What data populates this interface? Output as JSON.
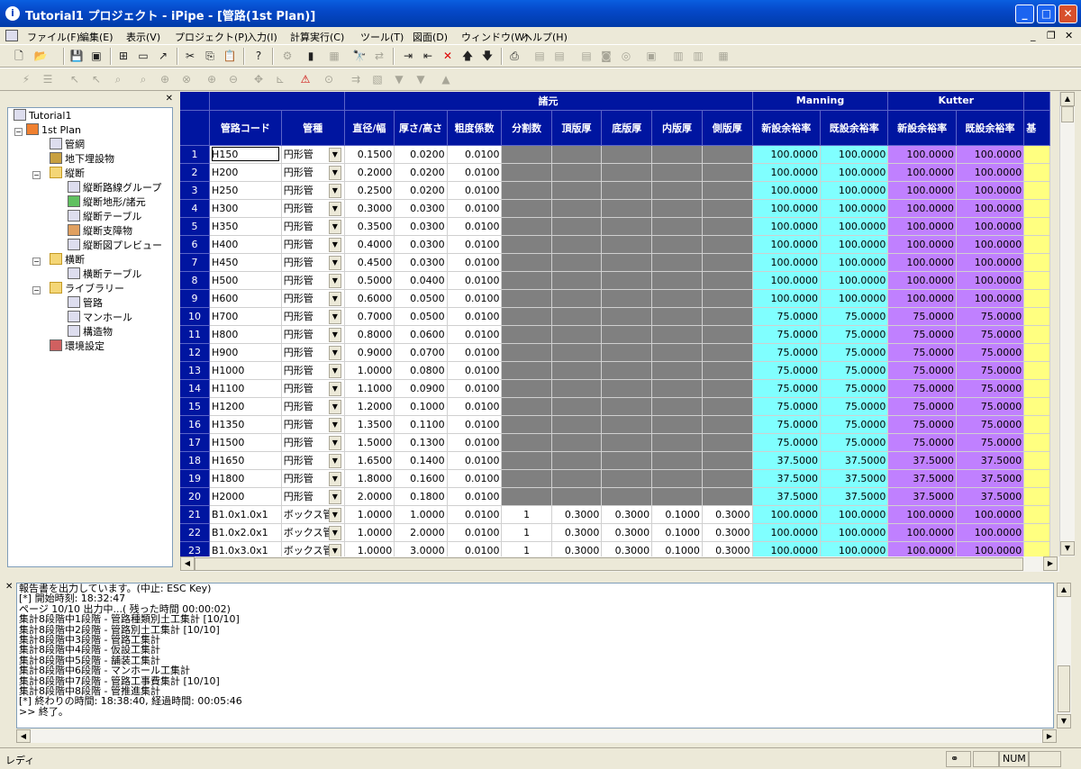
{
  "window": {
    "title": "Tutorial1 プロジェクト - iPipe - [管路(1st Plan)]"
  },
  "menu": [
    {
      "label": "ファイル(F)",
      "icon": "app-doc-icon"
    },
    {
      "label": "編集(E)"
    },
    {
      "label": "表示(V)"
    },
    {
      "label": "プロジェクト(P)"
    },
    {
      "label": "入力(I)"
    },
    {
      "label": "計算実行(C)"
    },
    {
      "label": "ツール(T)"
    },
    {
      "label": "図面(D)"
    },
    {
      "label": "ウィンドウ(W)"
    },
    {
      "label": "ヘルプ(H)"
    }
  ],
  "tree": [
    {
      "label": "Tutorial1",
      "icon": "project-icon",
      "level": 0
    },
    {
      "label": "1st Plan",
      "icon": "plan-icon",
      "level": 1,
      "expanded": true
    },
    {
      "label": "管網",
      "icon": "network-icon",
      "level": 2
    },
    {
      "label": "地下埋設物",
      "icon": "buried-icon",
      "level": 2
    },
    {
      "label": "縦断",
      "icon": "folder-icon",
      "level": 2,
      "expanded": true
    },
    {
      "label": "縦断路線グループ",
      "icon": "route-group-icon",
      "level": 3
    },
    {
      "label": "縦断地形/諸元",
      "icon": "terrain-icon",
      "level": 3
    },
    {
      "label": "縦断テーブル",
      "icon": "table-icon",
      "level": 3
    },
    {
      "label": "縦断支障物",
      "icon": "obstacle-icon",
      "level": 3
    },
    {
      "label": "縦断図プレビュー",
      "icon": "preview-icon",
      "level": 3
    },
    {
      "label": "横断",
      "icon": "folder-icon",
      "level": 2,
      "expanded": true
    },
    {
      "label": "横断テーブル",
      "icon": "table-icon",
      "level": 3
    },
    {
      "label": "ライブラリー",
      "icon": "folder-icon",
      "level": 2,
      "expanded": true
    },
    {
      "label": "管路",
      "icon": "pipe-icon",
      "level": 3,
      "selected": true
    },
    {
      "label": "マンホール",
      "icon": "manhole-icon",
      "level": 3
    },
    {
      "label": "構造物",
      "icon": "structure-icon",
      "level": 3
    },
    {
      "label": "環境設定",
      "icon": "settings-icon",
      "level": 2
    }
  ],
  "grid": {
    "group_headers": {
      "spec": "諸元",
      "manning": "Manning",
      "kutter": "Kutter"
    },
    "columns": [
      "管路コード",
      "管種",
      "直径/幅",
      "厚さ/高さ",
      "粗度係数",
      "分割数",
      "頂版厚",
      "底版厚",
      "内版厚",
      "側版厚",
      "新設余裕率",
      "既設余裕率",
      "新設余裕率",
      "既設余裕率",
      "基"
    ],
    "rows": [
      {
        "n": "1",
        "code": "H150",
        "type": "円形管",
        "d": "0.1500",
        "t": "0.0200",
        "r": "0.0100",
        "mn": "100.0000",
        "me": "100.0000",
        "kn": "100.0000",
        "ke": "100.0000"
      },
      {
        "n": "2",
        "code": "H200",
        "type": "円形管",
        "d": "0.2000",
        "t": "0.0200",
        "r": "0.0100",
        "mn": "100.0000",
        "me": "100.0000",
        "kn": "100.0000",
        "ke": "100.0000"
      },
      {
        "n": "3",
        "code": "H250",
        "type": "円形管",
        "d": "0.2500",
        "t": "0.0200",
        "r": "0.0100",
        "mn": "100.0000",
        "me": "100.0000",
        "kn": "100.0000",
        "ke": "100.0000"
      },
      {
        "n": "4",
        "code": "H300",
        "type": "円形管",
        "d": "0.3000",
        "t": "0.0300",
        "r": "0.0100",
        "mn": "100.0000",
        "me": "100.0000",
        "kn": "100.0000",
        "ke": "100.0000"
      },
      {
        "n": "5",
        "code": "H350",
        "type": "円形管",
        "d": "0.3500",
        "t": "0.0300",
        "r": "0.0100",
        "mn": "100.0000",
        "me": "100.0000",
        "kn": "100.0000",
        "ke": "100.0000"
      },
      {
        "n": "6",
        "code": "H400",
        "type": "円形管",
        "d": "0.4000",
        "t": "0.0300",
        "r": "0.0100",
        "mn": "100.0000",
        "me": "100.0000",
        "kn": "100.0000",
        "ke": "100.0000"
      },
      {
        "n": "7",
        "code": "H450",
        "type": "円形管",
        "d": "0.4500",
        "t": "0.0300",
        "r": "0.0100",
        "mn": "100.0000",
        "me": "100.0000",
        "kn": "100.0000",
        "ke": "100.0000"
      },
      {
        "n": "8",
        "code": "H500",
        "type": "円形管",
        "d": "0.5000",
        "t": "0.0400",
        "r": "0.0100",
        "mn": "100.0000",
        "me": "100.0000",
        "kn": "100.0000",
        "ke": "100.0000"
      },
      {
        "n": "9",
        "code": "H600",
        "type": "円形管",
        "d": "0.6000",
        "t": "0.0500",
        "r": "0.0100",
        "mn": "100.0000",
        "me": "100.0000",
        "kn": "100.0000",
        "ke": "100.0000"
      },
      {
        "n": "10",
        "code": "H700",
        "type": "円形管",
        "d": "0.7000",
        "t": "0.0500",
        "r": "0.0100",
        "mn": "75.0000",
        "me": "75.0000",
        "kn": "75.0000",
        "ke": "75.0000"
      },
      {
        "n": "11",
        "code": "H800",
        "type": "円形管",
        "d": "0.8000",
        "t": "0.0600",
        "r": "0.0100",
        "mn": "75.0000",
        "me": "75.0000",
        "kn": "75.0000",
        "ke": "75.0000"
      },
      {
        "n": "12",
        "code": "H900",
        "type": "円形管",
        "d": "0.9000",
        "t": "0.0700",
        "r": "0.0100",
        "mn": "75.0000",
        "me": "75.0000",
        "kn": "75.0000",
        "ke": "75.0000"
      },
      {
        "n": "13",
        "code": "H1000",
        "type": "円形管",
        "d": "1.0000",
        "t": "0.0800",
        "r": "0.0100",
        "mn": "75.0000",
        "me": "75.0000",
        "kn": "75.0000",
        "ke": "75.0000"
      },
      {
        "n": "14",
        "code": "H1100",
        "type": "円形管",
        "d": "1.1000",
        "t": "0.0900",
        "r": "0.0100",
        "mn": "75.0000",
        "me": "75.0000",
        "kn": "75.0000",
        "ke": "75.0000"
      },
      {
        "n": "15",
        "code": "H1200",
        "type": "円形管",
        "d": "1.2000",
        "t": "0.1000",
        "r": "0.0100",
        "mn": "75.0000",
        "me": "75.0000",
        "kn": "75.0000",
        "ke": "75.0000"
      },
      {
        "n": "16",
        "code": "H1350",
        "type": "円形管",
        "d": "1.3500",
        "t": "0.1100",
        "r": "0.0100",
        "mn": "75.0000",
        "me": "75.0000",
        "kn": "75.0000",
        "ke": "75.0000"
      },
      {
        "n": "17",
        "code": "H1500",
        "type": "円形管",
        "d": "1.5000",
        "t": "0.1300",
        "r": "0.0100",
        "mn": "75.0000",
        "me": "75.0000",
        "kn": "75.0000",
        "ke": "75.0000"
      },
      {
        "n": "18",
        "code": "H1650",
        "type": "円形管",
        "d": "1.6500",
        "t": "0.1400",
        "r": "0.0100",
        "mn": "37.5000",
        "me": "37.5000",
        "kn": "37.5000",
        "ke": "37.5000"
      },
      {
        "n": "19",
        "code": "H1800",
        "type": "円形管",
        "d": "1.8000",
        "t": "0.1600",
        "r": "0.0100",
        "mn": "37.5000",
        "me": "37.5000",
        "kn": "37.5000",
        "ke": "37.5000"
      },
      {
        "n": "20",
        "code": "H2000",
        "type": "円形管",
        "d": "2.0000",
        "t": "0.1800",
        "r": "0.0100",
        "mn": "37.5000",
        "me": "37.5000",
        "kn": "37.5000",
        "ke": "37.5000"
      },
      {
        "n": "21",
        "code": "B1.0x1.0x1",
        "type": "ボックス管",
        "d": "1.0000",
        "t": "1.0000",
        "r": "0.0100",
        "div": "1",
        "top": "0.3000",
        "bot": "0.3000",
        "inn": "0.1000",
        "side": "0.3000",
        "mn": "100.0000",
        "me": "100.0000",
        "kn": "100.0000",
        "ke": "100.0000"
      },
      {
        "n": "22",
        "code": "B1.0x2.0x1",
        "type": "ボックス管",
        "d": "1.0000",
        "t": "2.0000",
        "r": "0.0100",
        "div": "1",
        "top": "0.3000",
        "bot": "0.3000",
        "inn": "0.1000",
        "side": "0.3000",
        "mn": "100.0000",
        "me": "100.0000",
        "kn": "100.0000",
        "ke": "100.0000"
      },
      {
        "n": "23",
        "code": "B1.0x3.0x1",
        "type": "ボックス管",
        "d": "1.0000",
        "t": "3.0000",
        "r": "0.0100",
        "div": "1",
        "top": "0.3000",
        "bot": "0.3000",
        "inn": "0.1000",
        "side": "0.3000",
        "mn": "100.0000",
        "me": "100.0000",
        "kn": "100.0000",
        "ke": "100.0000"
      }
    ]
  },
  "output": {
    "lines": [
      "報告書を出力しています。(中止: ESC Key)",
      "[*] 開始時刻: 18:32:47",
      "ページ 10/10 出力中...( 残った時間 00:00:02)",
      "集計8段階中1段階 - 管路種類別土工集計 [10/10]",
      "集計8段階中2段階 - 管路別土工集計 [10/10]",
      "集計8段階中3段階 - 管路工集計",
      "集計8段階中4段階 - 仮設工集計",
      "集計8段階中5段階 - 舗装工集計",
      "集計8段階中6段階 - マンホール工集計",
      "集計8段階中7段階 - 管路工事費集計 [10/10]",
      "集計8段階中8段階 - 管推進集計",
      "[*] 終わりの時間: 18:38:40, 経過時間: 00:05:46",
      ">> 終了。"
    ]
  },
  "status": {
    "ready": "レディ",
    "num": "NUM"
  }
}
